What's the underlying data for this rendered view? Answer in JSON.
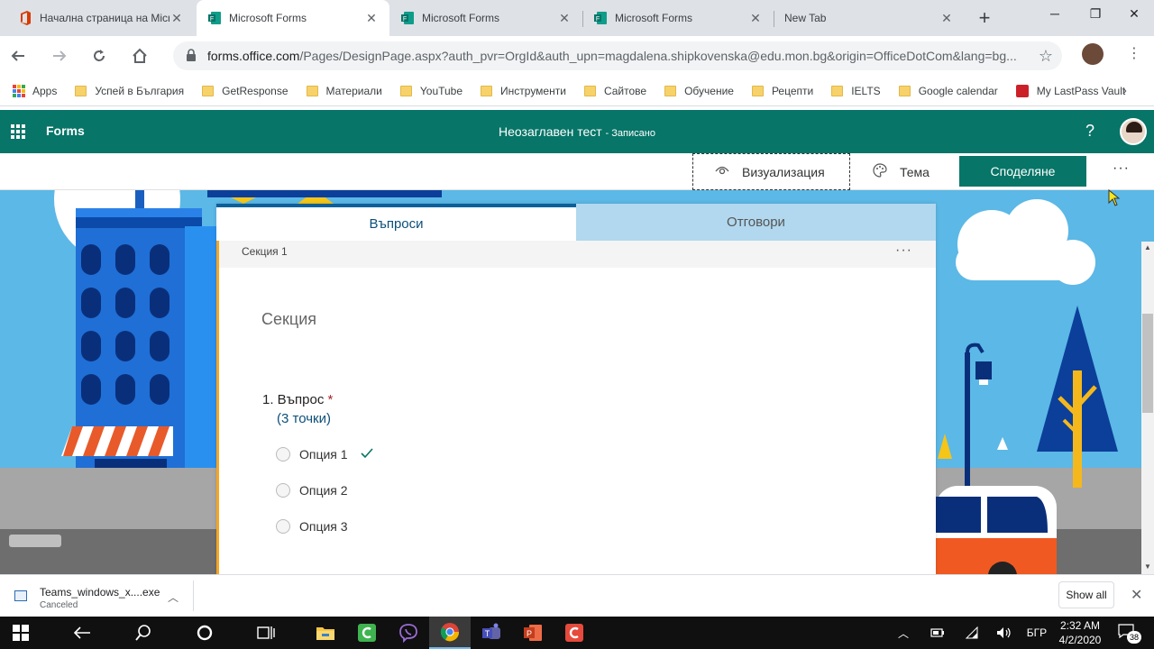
{
  "browser": {
    "tabs": [
      {
        "title": "Начална страница на Micro",
        "favicon": "office-icon",
        "active": false
      },
      {
        "title": "Microsoft Forms",
        "favicon": "forms-icon",
        "active": true
      },
      {
        "title": "Microsoft Forms",
        "favicon": "forms-icon",
        "active": false
      },
      {
        "title": "Microsoft Forms",
        "favicon": "forms-icon",
        "active": false
      },
      {
        "title": "New Tab",
        "favicon": "",
        "active": false
      }
    ],
    "url_host": "forms.office.com",
    "url_rest": "/Pages/DesignPage.aspx?auth_pvr=OrgId&auth_upn=magdalena.shipkovenska@edu.mon.bg&origin=OfficeDotCom&lang=bg...",
    "bookmarks": [
      {
        "label": "Apps",
        "icon": "apps-grid-icon"
      },
      {
        "label": "Успей в България",
        "icon": "folder-icon"
      },
      {
        "label": "GetResponse",
        "icon": "folder-icon"
      },
      {
        "label": "Материали",
        "icon": "folder-icon"
      },
      {
        "label": "YouTube",
        "icon": "folder-icon"
      },
      {
        "label": "Инструменти",
        "icon": "folder-icon"
      },
      {
        "label": "Сайтове",
        "icon": "folder-icon"
      },
      {
        "label": "Обучение",
        "icon": "folder-icon"
      },
      {
        "label": "Рецепти",
        "icon": "folder-icon"
      },
      {
        "label": "IELTS",
        "icon": "folder-icon"
      },
      {
        "label": "Google calendar",
        "icon": "folder-icon"
      },
      {
        "label": "My LastPass Vault",
        "icon": "lastpass-icon"
      }
    ]
  },
  "forms": {
    "brand": "Forms",
    "doc_title": "Неозаглавен тест",
    "saved_status": "- Записано",
    "help": "?",
    "commands": {
      "preview": "Визуализация",
      "theme": "Тема",
      "share": "Споделяне",
      "more": "···"
    },
    "tabs": {
      "questions": "Въпроси",
      "responses": "Отговори"
    },
    "section": {
      "header_label": "Секция 1",
      "menu": "···",
      "title": "Секция"
    },
    "question": {
      "number_title": "1. Въпрос",
      "required_mark": "*",
      "points": "(3 точки)",
      "options": [
        {
          "label": "Опция 1",
          "correct": true
        },
        {
          "label": "Опция 2",
          "correct": false
        },
        {
          "label": "Опция 3",
          "correct": false
        }
      ]
    }
  },
  "downloads": {
    "file_name": "Teams_windows_x....exe",
    "status": "Canceled",
    "show_all": "Show all"
  },
  "taskbar": {
    "language": "БГР",
    "time": "2:32 AM",
    "date": "4/2/2020",
    "notifications": "38"
  },
  "colors": {
    "forms_green": "#077568",
    "tab_accent": "#0b5f9a",
    "section_accent": "#f5a623",
    "scene_sky": "#5cb8e6"
  }
}
